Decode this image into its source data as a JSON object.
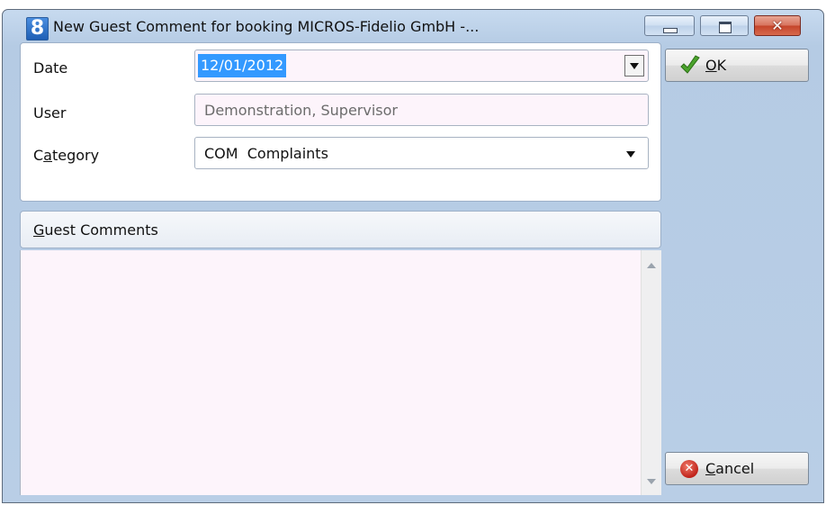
{
  "window": {
    "title": "New Guest Comment for booking MICROS-Fidelio GmbH -...",
    "app_icon_text": "8",
    "close_glyph": "✕"
  },
  "form": {
    "date": {
      "label": "Date",
      "value": "12/01/2012"
    },
    "user": {
      "label": "User",
      "value": "Demonstration, Supervisor"
    },
    "category": {
      "label_prefix": "C",
      "label_mnemonic": "a",
      "label_suffix": "tegory",
      "code": "COM",
      "name": "Complaints"
    }
  },
  "guest_comments": {
    "label_mnemonic": "G",
    "label_suffix": "uest Comments",
    "value": ""
  },
  "buttons": {
    "ok": {
      "mnemonic": "O",
      "rest": "K"
    },
    "cancel": {
      "mnemonic": "C",
      "rest": "ancel"
    }
  }
}
